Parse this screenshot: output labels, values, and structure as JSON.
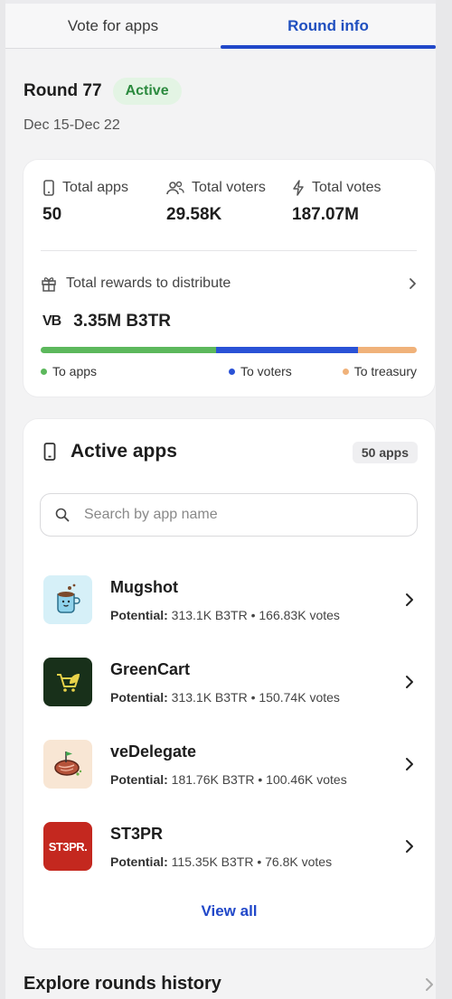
{
  "tabs": [
    {
      "label": "Vote for apps",
      "active": false
    },
    {
      "label": "Round info",
      "active": true
    }
  ],
  "round": {
    "title": "Round 77",
    "status": "Active",
    "dates": "Dec 15-Dec 22"
  },
  "stats": {
    "total_apps_label": "Total apps",
    "total_apps_value": "50",
    "total_voters_label": "Total voters",
    "total_voters_value": "29.58K",
    "total_votes_label": "Total votes",
    "total_votes_value": "187.07M"
  },
  "rewards": {
    "label": "Total rewards to distribute",
    "token_symbol": "VB",
    "amount": "3.35M B3TR",
    "distribution": [
      {
        "label": "To apps",
        "fraction": 0.42,
        "color": "#5cb85c"
      },
      {
        "label": "To voters",
        "fraction": 0.34,
        "color": "#2a52d6"
      },
      {
        "label": "To treasury",
        "fraction": 0.14,
        "color": "#f0b27a"
      }
    ]
  },
  "active_apps": {
    "title": "Active apps",
    "count_badge": "50 apps",
    "search_placeholder": "Search by app name",
    "view_all_label": "View all",
    "apps": [
      {
        "name": "Mugshot",
        "potential_label": "Potential:",
        "potential": "313.1K B3TR • 166.83K votes"
      },
      {
        "name": "GreenCart",
        "potential_label": "Potential:",
        "potential": "313.1K B3TR • 150.74K votes"
      },
      {
        "name": "veDelegate",
        "potential_label": "Potential:",
        "potential": "181.76K B3TR • 100.46K votes"
      },
      {
        "name": "ST3PR",
        "potential_label": "Potential:",
        "potential": "115.35K B3TR • 76.8K votes"
      }
    ],
    "logo_text_st3pr": "ST3PR."
  },
  "explore": {
    "label": "Explore rounds history"
  },
  "colors": {
    "accent": "#2148c9",
    "active_badge_bg": "#e3f4e4",
    "active_badge_text": "#2b8a3e"
  }
}
